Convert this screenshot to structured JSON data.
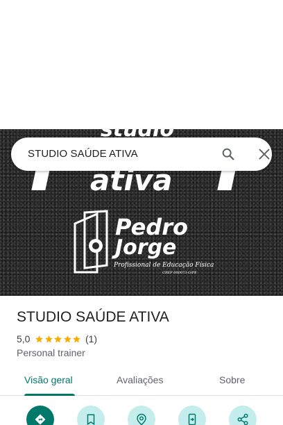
{
  "search": {
    "query": "STUDIO SAÚDE ATIVA",
    "search_icon": "search-icon",
    "close_icon": "close-icon"
  },
  "hero": {
    "logo_top_text": "studio",
    "logo_mid_text": "ativa",
    "logo_name_line1": "Pedro",
    "logo_name_line2": "Jorge",
    "logo_subtitle": "Profissional de Educação Física",
    "logo_registration": "CREF 000073-G/PE"
  },
  "place": {
    "title": "STUDIO SAÚDE ATIVA",
    "rating": "5,0",
    "stars": 5,
    "review_count": "(1)",
    "category": "Personal trainer"
  },
  "tabs": [
    {
      "label": "Visão geral",
      "active": true
    },
    {
      "label": "Avaliações",
      "active": false
    },
    {
      "label": "Sobre",
      "active": false
    }
  ],
  "actions": [
    {
      "icon": "directions-icon"
    },
    {
      "icon": "bookmark-icon"
    },
    {
      "icon": "nearby-icon"
    },
    {
      "icon": "send-to-phone-icon"
    },
    {
      "icon": "share-icon"
    }
  ],
  "colors": {
    "accent": "#00796b",
    "action_bg": "#c4eeee",
    "star": "#f9ab00"
  }
}
